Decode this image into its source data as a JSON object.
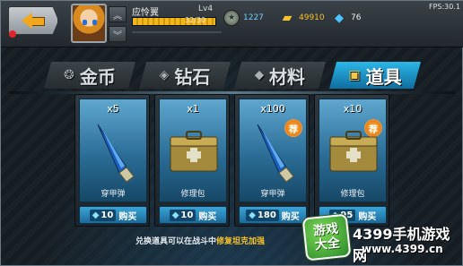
{
  "header": {
    "player_name": "应怜翼",
    "level": "Lv4",
    "xp_text": "32/30",
    "xp_fraction": 1.0,
    "fps": "FPS:30.1"
  },
  "resources": {
    "medals": "1227",
    "gold": "49910",
    "gems": "76"
  },
  "tabs": [
    {
      "label": "金币",
      "icon": "coins-icon",
      "active": false
    },
    {
      "label": "钻石",
      "icon": "diamond-icon",
      "active": false
    },
    {
      "label": "材料",
      "icon": "material-icon",
      "active": false
    },
    {
      "label": "道具",
      "icon": "toolbox-icon",
      "active": true
    }
  ],
  "items": [
    {
      "qty": "x5",
      "name": "穿甲弹",
      "price": "10",
      "buy_label": "购买",
      "recommended": false,
      "art": "ap-shell"
    },
    {
      "qty": "x1",
      "name": "修理包",
      "price": "10",
      "buy_label": "购买",
      "recommended": false,
      "art": "repair-kit"
    },
    {
      "qty": "x100",
      "name": "穿甲弹",
      "price": "180",
      "buy_label": "购买",
      "recommended": true,
      "art": "ap-shell"
    },
    {
      "qty": "x10",
      "name": "修理包",
      "price": "95",
      "buy_label": "购买",
      "recommended": true,
      "art": "repair-kit"
    }
  ],
  "badge_text": "荐",
  "footer": {
    "text_before": "兑换道具可以在战斗中",
    "text_highlight": "修复坦克加强"
  },
  "watermark": {
    "badge_line1": "游戏",
    "badge_line2": "大全",
    "title": "4399手机游戏网",
    "url": "www.4399.cn"
  },
  "colors": {
    "accent_blue": "#2bb7e8",
    "gold": "#f7c12a",
    "badge_orange": "#e06a0a"
  }
}
